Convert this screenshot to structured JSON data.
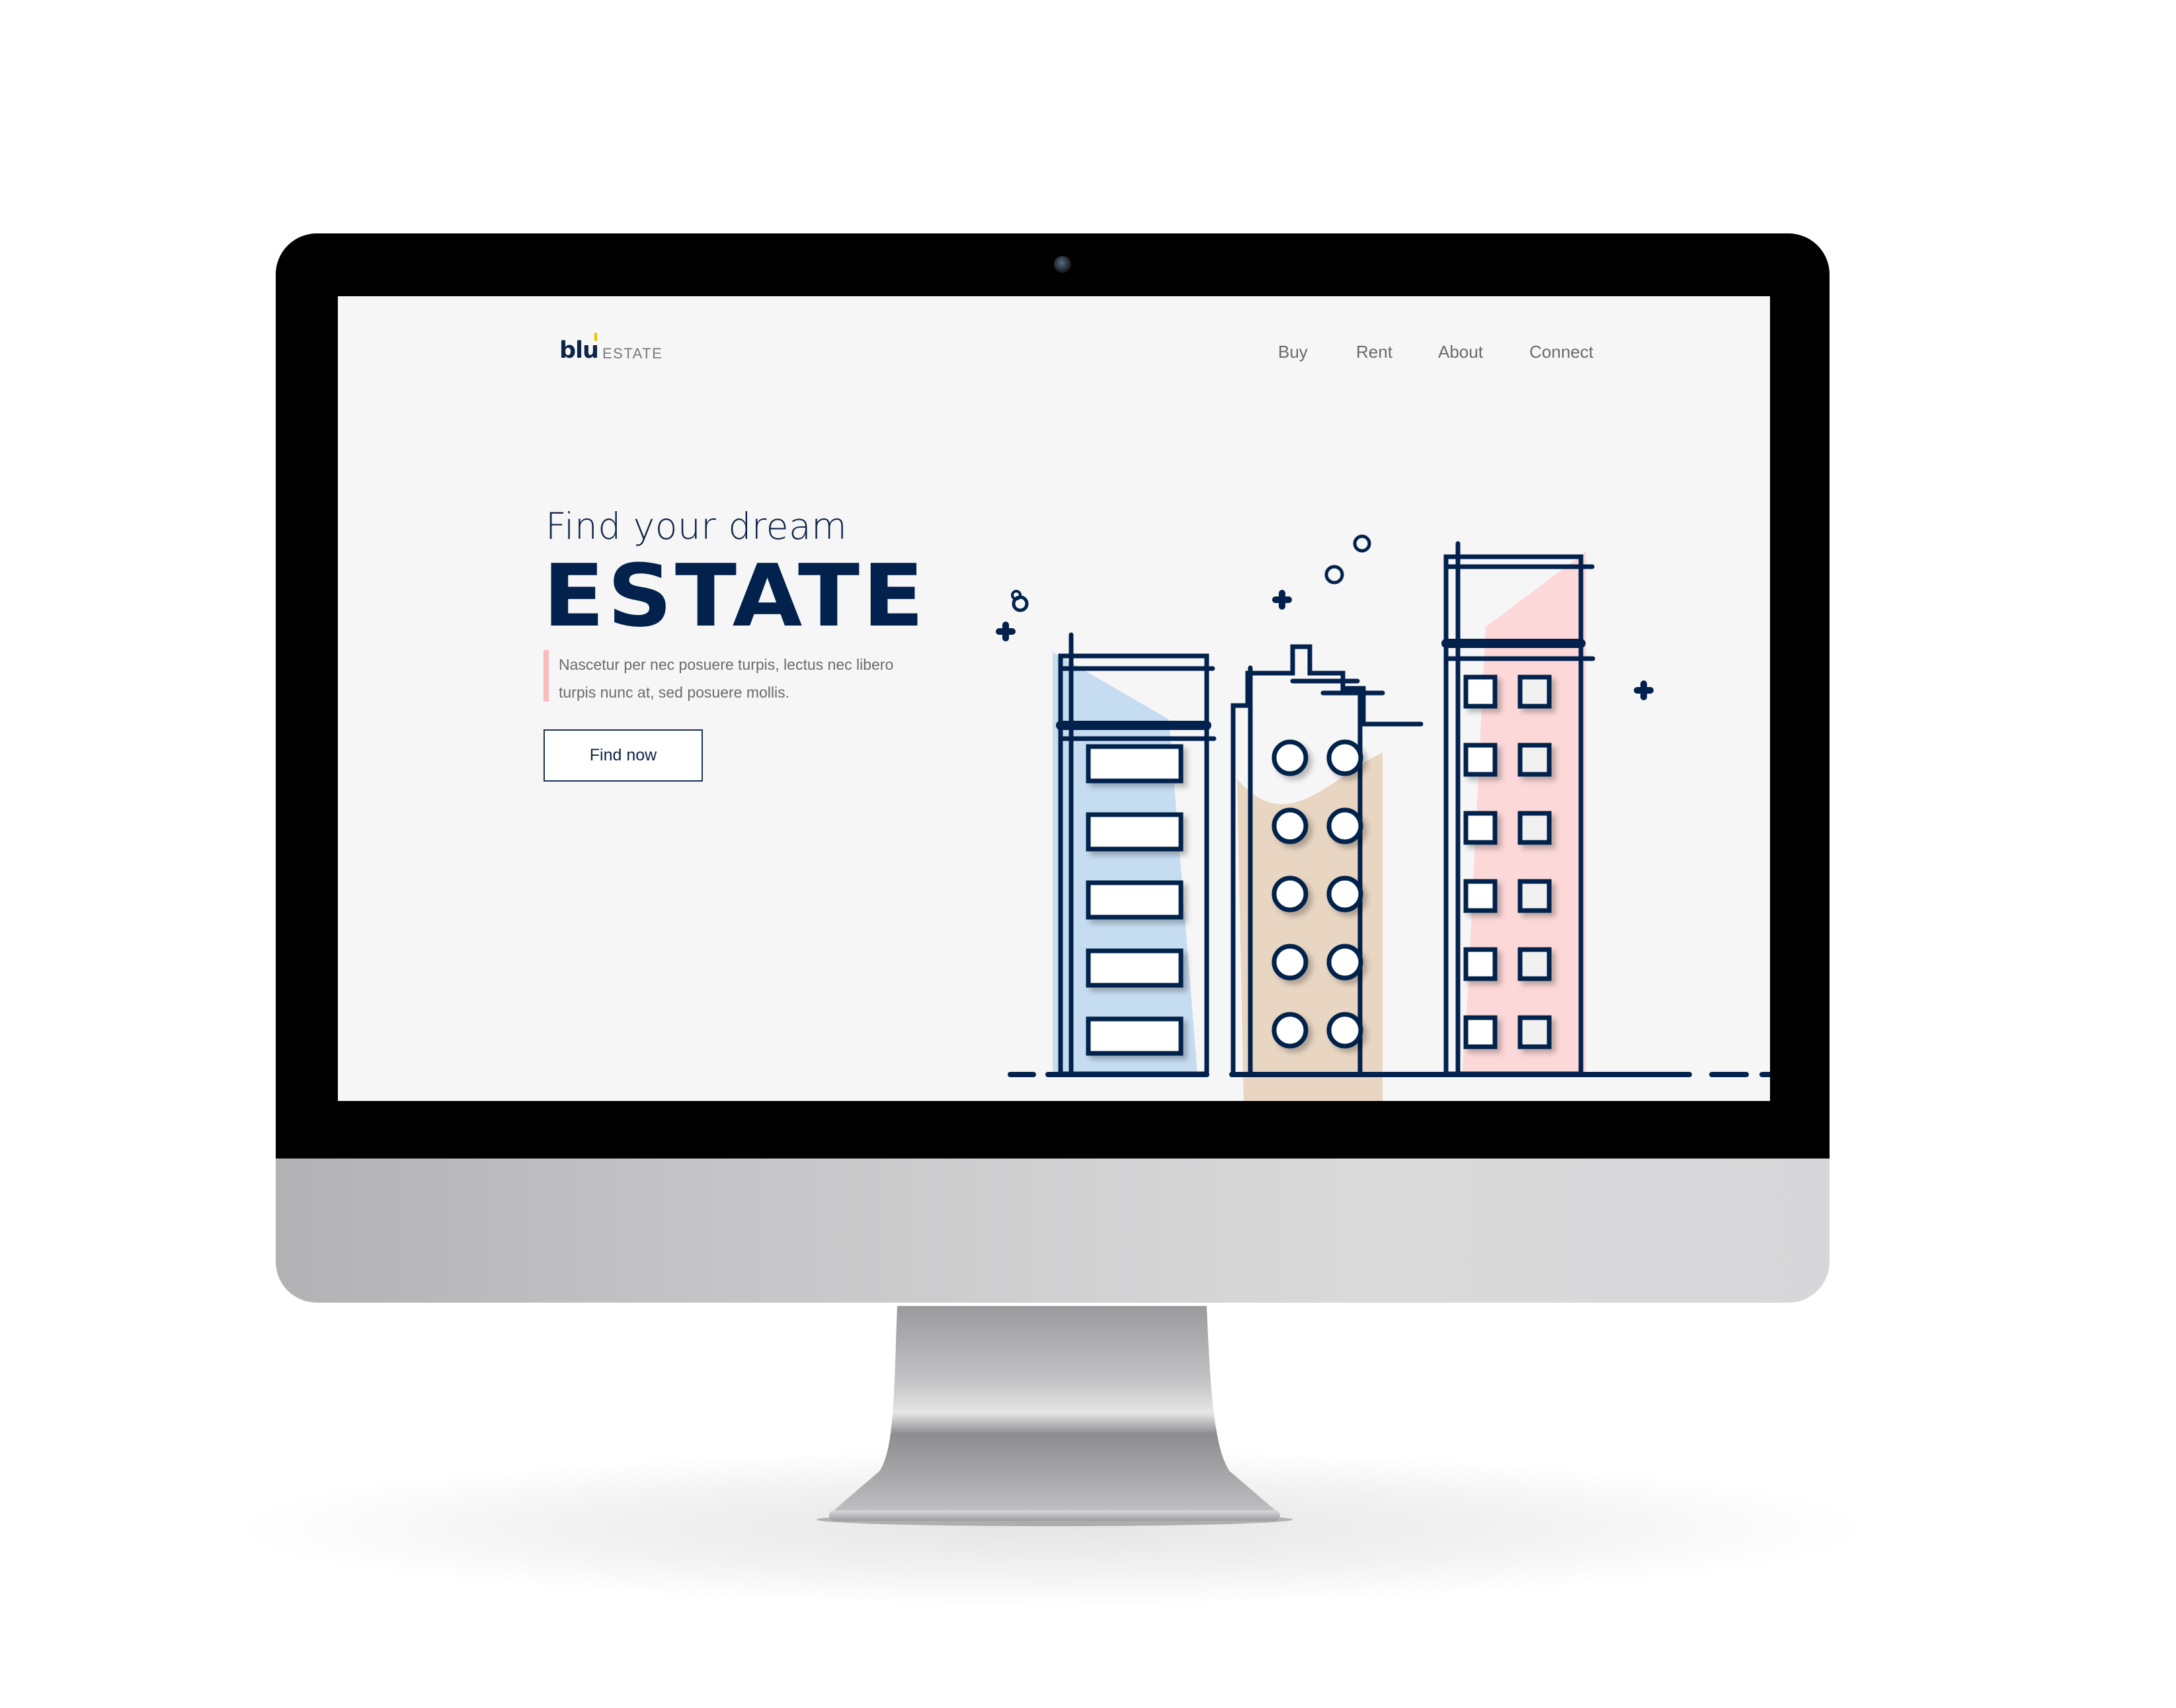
{
  "site": {
    "logo": {
      "primary": "blu",
      "secondary": "ESTATE",
      "accent_color": "#f2c100"
    },
    "nav": {
      "items": [
        {
          "label": "Buy"
        },
        {
          "label": "Rent"
        },
        {
          "label": "About"
        },
        {
          "label": "Connect"
        }
      ]
    },
    "hero": {
      "subtitle": "Find your dream",
      "title": "ESTATE",
      "description": "Nascetur per nec posuere turpis, lectus nec libero turpis nunc at, sed posuere mollis.",
      "cta_label": "Find now"
    },
    "illustration": {
      "subject": "three city buildings",
      "buildings": [
        {
          "name": "left-building",
          "window_shape": "rectangle",
          "window_count": 5,
          "tint": "#c6dcf0"
        },
        {
          "name": "middle-building",
          "window_shape": "circle",
          "window_count": 10,
          "tint": "#e8d5c2"
        },
        {
          "name": "right-building",
          "window_shape": "square",
          "window_count": 12,
          "tint": "#fdd8d8"
        }
      ]
    },
    "colors": {
      "navy": "#02214c",
      "background": "#f6f6f6",
      "text_gray": "#6b6b6b",
      "accent_pink": "#f9bcbc"
    }
  },
  "device": {
    "type": "desktop monitor"
  }
}
